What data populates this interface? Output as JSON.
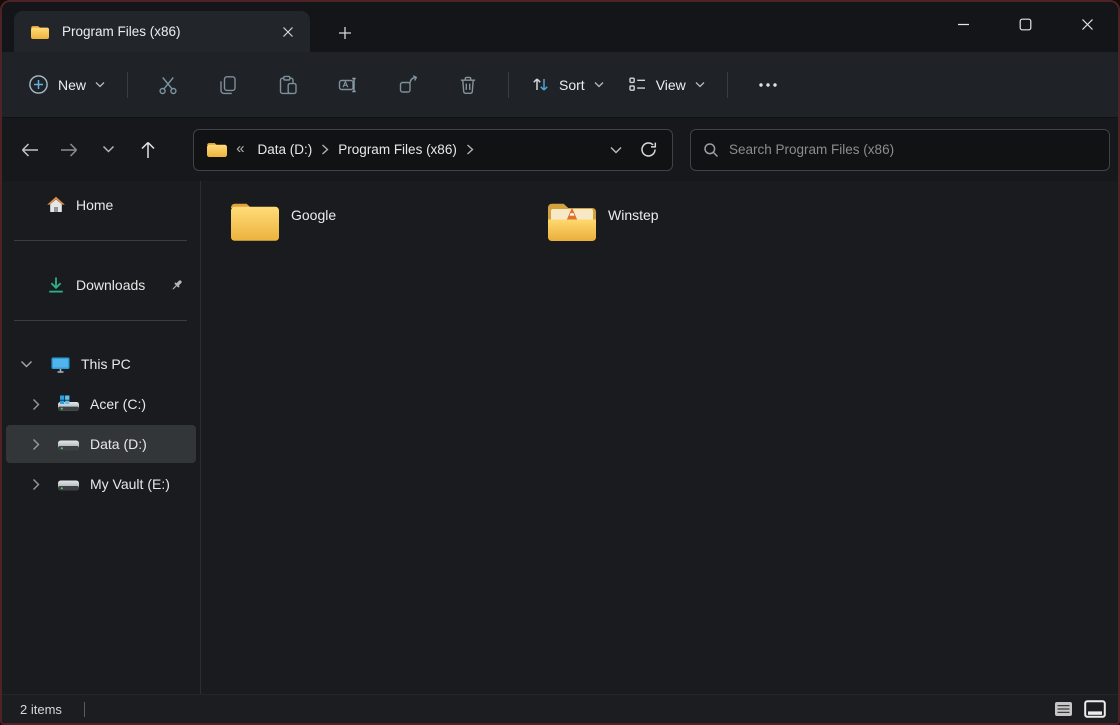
{
  "window": {
    "title": "Program Files (x86)",
    "border_color": "#4d2325",
    "controls": [
      "minimize-button",
      "maximize-button",
      "close-button"
    ]
  },
  "titlebar": {
    "tab": {
      "label": "Program Files (x86)",
      "icon": "folder-icon",
      "close_icon": "close-icon"
    },
    "new_tab_icon": "plus-icon"
  },
  "toolbar": {
    "new_label": "New",
    "new_icon": "plus-circle-icon",
    "sort_label": "Sort",
    "sort_icon": "sort-arrows-icon",
    "view_label": "View",
    "view_icon": "view-list-icon",
    "icon_buttons": [
      "cut-icon",
      "copy-icon",
      "paste-icon",
      "rename-icon",
      "share-icon",
      "delete-icon"
    ],
    "more_icon": "ellipsis-icon"
  },
  "address": {
    "nav_icons": [
      "back-icon",
      "forward-icon",
      "recent-locations-chevron-icon",
      "up-icon"
    ],
    "root_icon": "folder-icon",
    "overflow_glyph": "«",
    "crumbs": [
      "Data (D:)",
      "Program Files (x86)"
    ],
    "dropdown_icon": "chevron-down-icon",
    "refresh_icon": "refresh-icon",
    "search_placeholder": "Search Program Files (x86)",
    "search_icon": "search-icon"
  },
  "sidebar": {
    "items": [
      {
        "label": "Home",
        "icon": "home-icon"
      },
      {
        "label": "Downloads",
        "icon": "downloads-icon",
        "pinned": true
      },
      {
        "label": "This PC",
        "icon": "this-pc-icon",
        "expanded": true
      },
      {
        "label": "Acer (C:)",
        "icon": "system-drive-icon"
      },
      {
        "label": "Data (D:)",
        "icon": "drive-icon",
        "selected": true
      },
      {
        "label": "My Vault (E:)",
        "icon": "drive-icon"
      }
    ]
  },
  "content": {
    "items": [
      {
        "name": "Google",
        "icon": "folder-icon"
      },
      {
        "name": "Winstep",
        "icon": "folder-with-content-icon"
      }
    ]
  },
  "statusbar": {
    "count": "2 items",
    "view_buttons": [
      "details-view-icon",
      "large-thumbnails-view-icon"
    ],
    "active_view": "large-thumbnails-view-icon"
  },
  "colors": {
    "accent_blue": "#4ea3d8",
    "folder_yellow": "#f3bb45",
    "downloads_green": "#2fb08c",
    "selection_gray": "#333639"
  }
}
